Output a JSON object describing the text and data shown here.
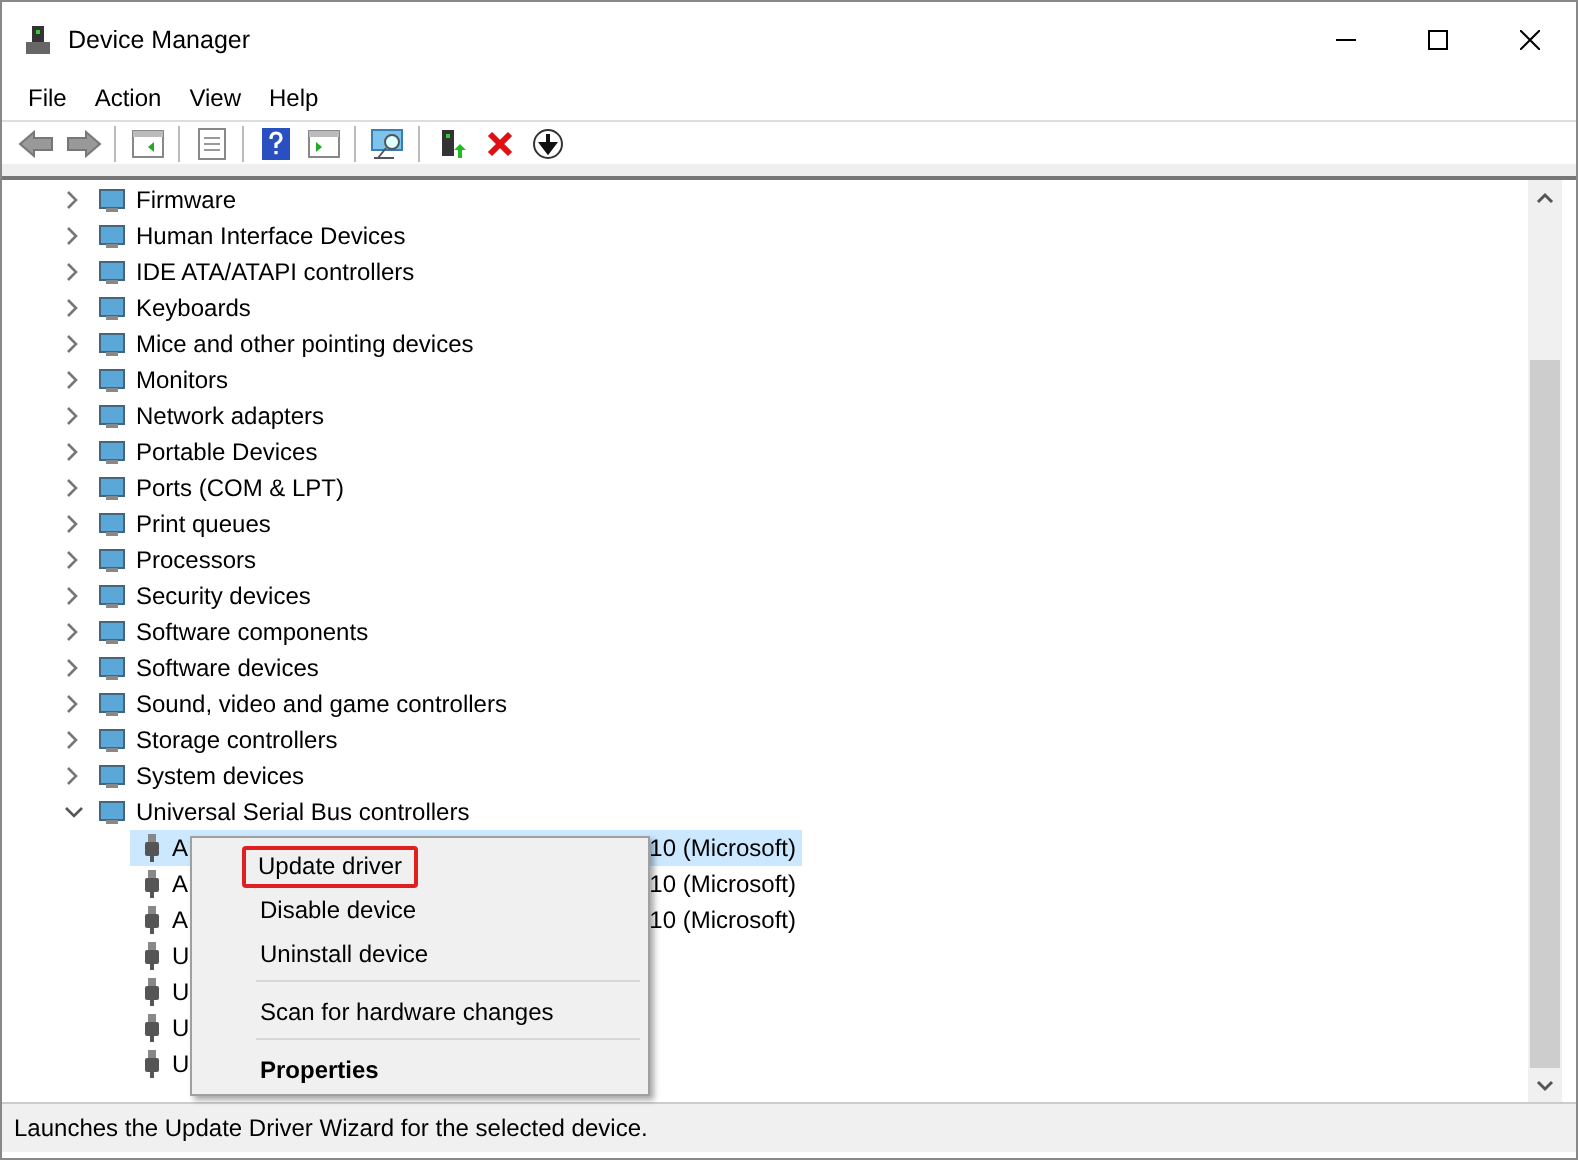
{
  "window": {
    "title": "Device Manager"
  },
  "menu_bar": [
    "File",
    "Action",
    "View",
    "Help"
  ],
  "tree": {
    "items": [
      {
        "label": "Firmware",
        "expanded": false
      },
      {
        "label": "Human Interface Devices",
        "expanded": false
      },
      {
        "label": "IDE ATA/ATAPI controllers",
        "expanded": false
      },
      {
        "label": "Keyboards",
        "expanded": false
      },
      {
        "label": "Mice and other pointing devices",
        "expanded": false
      },
      {
        "label": "Monitors",
        "expanded": false
      },
      {
        "label": "Network adapters",
        "expanded": false
      },
      {
        "label": "Portable Devices",
        "expanded": false
      },
      {
        "label": "Ports (COM & LPT)",
        "expanded": false
      },
      {
        "label": "Print queues",
        "expanded": false
      },
      {
        "label": "Processors",
        "expanded": false
      },
      {
        "label": "Security devices",
        "expanded": false
      },
      {
        "label": "Software components",
        "expanded": false
      },
      {
        "label": "Software devices",
        "expanded": false
      },
      {
        "label": "Sound, video and game controllers",
        "expanded": false
      },
      {
        "label": "Storage controllers",
        "expanded": false
      },
      {
        "label": "System devices",
        "expanded": false
      },
      {
        "label": "Universal Serial Bus controllers",
        "expanded": true,
        "children": [
          {
            "label_start": "A",
            "label_end": "10 (Microsoft)",
            "selected": true
          },
          {
            "label_start": "A",
            "label_end": "10 (Microsoft)",
            "selected": false
          },
          {
            "label_start": "A",
            "label_end": "10 (Microsoft)",
            "selected": false
          },
          {
            "label_start": "U",
            "selected": false
          },
          {
            "label_start": "U",
            "selected": false
          },
          {
            "label_start": "U",
            "selected": false
          },
          {
            "label_start": "U",
            "selected": false
          }
        ]
      }
    ]
  },
  "context_menu": {
    "items": [
      {
        "kind": "item",
        "label": "Update driver",
        "highlighted": true
      },
      {
        "kind": "item",
        "label": "Disable device",
        "highlighted": false
      },
      {
        "kind": "item",
        "label": "Uninstall device",
        "highlighted": false
      },
      {
        "kind": "separator"
      },
      {
        "kind": "item",
        "label": "Scan for hardware changes",
        "highlighted": false
      },
      {
        "kind": "separator"
      },
      {
        "kind": "default",
        "label": "Properties",
        "highlighted": false
      }
    ]
  },
  "status_bar": "Launches the Update Driver Wizard for the selected device."
}
